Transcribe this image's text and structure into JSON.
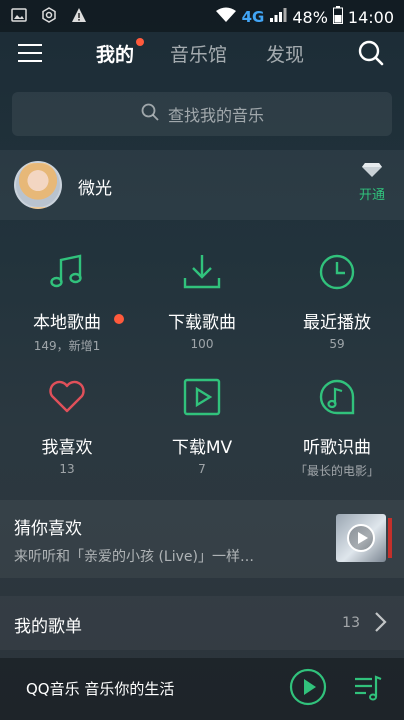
{
  "status": {
    "network": "4G",
    "battery": "48%",
    "time": "14:00"
  },
  "nav": {
    "tabs": [
      "我的",
      "音乐馆",
      "发现"
    ]
  },
  "search": {
    "placeholder": "查找我的音乐"
  },
  "user": {
    "name": "微光",
    "vip_label": "开通"
  },
  "grid": [
    {
      "label": "本地歌曲",
      "sub": "149，新增1",
      "icon": "music-note-icon",
      "badge": true
    },
    {
      "label": "下载歌曲",
      "sub": "100",
      "icon": "download-icon",
      "badge": false
    },
    {
      "label": "最近播放",
      "sub": "59",
      "icon": "clock-icon",
      "badge": false
    },
    {
      "label": "我喜欢",
      "sub": "13",
      "icon": "heart-icon",
      "badge": false
    },
    {
      "label": "下载MV",
      "sub": "7",
      "icon": "video-play-icon",
      "badge": false
    },
    {
      "label": "听歌识曲",
      "sub": "「最长的电影」",
      "icon": "music-recognize-icon",
      "badge": false
    }
  ],
  "recommend": {
    "title": "猜你喜欢",
    "desc": "来听听和「亲爱的小孩 (Live)」一样…"
  },
  "playlist": {
    "title": "我的歌单",
    "count": "13"
  },
  "player": {
    "text": "QQ音乐 音乐你的生活"
  },
  "colors": {
    "accent": "#31c27c",
    "badge": "#ff5a3c"
  }
}
